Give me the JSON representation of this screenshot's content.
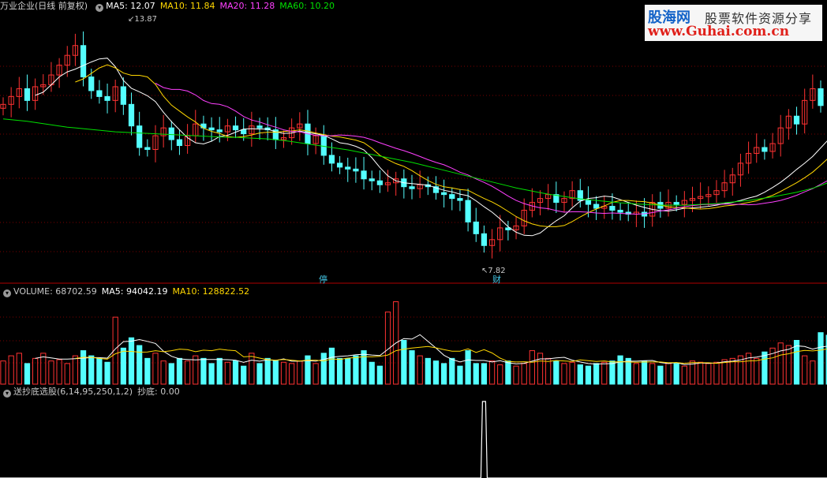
{
  "price_legend": {
    "title": "万业企业(日线 前复权)",
    "items": [
      {
        "label": "MA5: 12.07",
        "color": "#ffffff"
      },
      {
        "label": "MA10: 11.84",
        "color": "#ffd700"
      },
      {
        "label": "MA20: 11.28",
        "color": "#ff40ff"
      },
      {
        "label": "MA60: 10.20",
        "color": "#00e000"
      }
    ]
  },
  "volume_legend": {
    "items": [
      {
        "label": "VOLUME: 68702.59",
        "color": "#c8c8c8"
      },
      {
        "label": "MA5: 94042.19",
        "color": "#ffffff"
      },
      {
        "label": "MA10: 128822.52",
        "color": "#ffd700"
      }
    ]
  },
  "indicator_legend": {
    "items": [
      {
        "label": "送抄底选股(6,14,95,250,1,2)",
        "color": "#c8c8c8"
      },
      {
        "label": "抄底: 0.00",
        "color": "#c8c8c8"
      }
    ]
  },
  "annotations": {
    "high": "13.87",
    "low": "7.82"
  },
  "badges": {
    "b1": "停",
    "b2": "财"
  },
  "watermark": {
    "brand": "股海网",
    "slogan": "股票软件资源分享",
    "url": "www.Guhai.com.cn"
  },
  "colors": {
    "up": "#ff3232",
    "down": "#54ffff",
    "grid": "#7a0000",
    "separator": "#b00000"
  },
  "chart_data": [
    {
      "type": "candlestick",
      "series": [
        {
          "name": "MA5",
          "values": [
            null,
            null,
            null,
            null,
            12.33,
            12.41,
            12.6,
            12.8,
            12.93,
            13.0,
            13.09,
            13.18,
            13.26,
            13.28,
            13.06,
            12.71,
            12.51,
            12.42,
            12.32,
            12.17,
            11.9,
            11.66,
            11.45,
            11.25,
            11.12,
            11.09,
            11.16,
            11.28,
            11.31,
            11.39,
            11.47,
            11.48,
            11.47,
            11.47,
            11.4,
            11.36,
            11.37,
            11.42,
            11.38,
            11.35,
            11.31,
            11.22,
            11.12,
            11.09,
            11.03,
            10.94,
            10.74,
            10.49,
            10.28,
            10.15,
            10.1,
            10.08,
            10.06,
            10.04,
            9.97,
            9.91,
            9.87,
            9.81,
            9.77,
            9.64,
            9.49,
            9.35,
            9.18,
            8.98,
            8.84,
            8.76,
            8.75,
            8.82,
            8.98,
            9.13,
            9.26,
            9.46,
            9.63,
            9.7,
            9.72,
            9.76,
            9.74,
            9.67,
            9.6,
            9.53,
            9.47,
            9.42,
            9.39,
            9.38,
            9.41,
            9.45,
            9.46,
            9.48,
            9.5,
            9.53,
            9.57,
            9.6,
            9.65,
            9.71,
            9.76,
            9.86,
            9.98,
            10.11,
            10.27,
            10.44,
            10.6,
            10.77,
            10.99,
            11.21,
            11.41
          ]
        },
        {
          "name": "MA10",
          "values": [
            null,
            null,
            null,
            null,
            null,
            null,
            null,
            null,
            null,
            12.67,
            12.75,
            12.89,
            13.03,
            13.11,
            13.03,
            12.9,
            12.84,
            12.84,
            12.8,
            12.61,
            12.31,
            12.08,
            11.93,
            11.78,
            11.65,
            11.49,
            11.41,
            11.36,
            11.28,
            11.26,
            11.28,
            11.32,
            11.37,
            11.39,
            11.39,
            11.41,
            11.42,
            11.45,
            11.42,
            11.37,
            11.33,
            11.29,
            11.27,
            11.23,
            11.19,
            11.12,
            10.98,
            10.8,
            10.69,
            10.59,
            10.52,
            10.41,
            10.28,
            10.16,
            10.06,
            10.0,
            9.97,
            9.93,
            9.91,
            9.8,
            9.7,
            9.61,
            9.5,
            9.37,
            9.24,
            9.13,
            9.05,
            9.0,
            8.98,
            8.98,
            9.01,
            9.11,
            9.23,
            9.34,
            9.43,
            9.51,
            9.6,
            9.65,
            9.65,
            9.63,
            9.62,
            9.58,
            9.53,
            9.49,
            9.47,
            9.46,
            9.44,
            9.43,
            9.44,
            9.47,
            9.51,
            9.53,
            9.56,
            9.6,
            9.64,
            9.71,
            9.78,
            9.88,
            9.99,
            10.1,
            10.23,
            10.37,
            10.55,
            10.74,
            10.91
          ]
        },
        {
          "name": "MA20",
          "values": [
            null,
            null,
            null,
            null,
            null,
            null,
            null,
            null,
            null,
            null,
            null,
            null,
            null,
            null,
            null,
            null,
            null,
            null,
            null,
            12.64,
            12.53,
            12.48,
            12.48,
            12.44,
            12.34,
            12.2,
            12.12,
            12.1,
            12.04,
            11.93,
            11.79,
            11.7,
            11.65,
            11.58,
            11.52,
            11.45,
            11.41,
            11.4,
            11.35,
            11.31,
            11.3,
            11.3,
            11.32,
            11.31,
            11.29,
            11.26,
            11.2,
            11.12,
            11.05,
            10.98,
            10.92,
            10.85,
            10.77,
            10.69,
            10.62,
            10.56,
            10.47,
            10.37,
            10.3,
            10.2,
            10.11,
            10.01,
            9.89,
            9.76,
            9.65,
            9.57,
            9.51,
            9.46,
            9.44,
            9.39,
            9.35,
            9.36,
            9.36,
            9.35,
            9.33,
            9.32,
            9.33,
            9.32,
            9.31,
            9.3,
            9.31,
            9.34,
            9.38,
            9.41,
            9.45,
            9.49,
            9.52,
            9.54,
            9.55,
            9.55,
            9.56,
            9.55,
            9.55,
            9.54,
            9.55,
            9.58,
            9.61,
            9.65,
            9.71,
            9.78,
            9.87,
            9.95,
            10.06,
            10.17,
            10.27
          ]
        },
        {
          "name": "MA60",
          "values": [
            11.73,
            11.71,
            11.69,
            11.67,
            11.64,
            11.61,
            11.58,
            11.55,
            11.52,
            11.5,
            11.48,
            11.46,
            11.44,
            11.42,
            11.4,
            11.39,
            11.38,
            11.37,
            11.36,
            11.35,
            11.34,
            11.33,
            11.32,
            11.31,
            11.3,
            11.29,
            11.28,
            11.27,
            11.26,
            11.26,
            11.25,
            11.24,
            11.23,
            11.22,
            11.2,
            11.18,
            11.15,
            11.12,
            11.09,
            11.06,
            11.03,
            11.0,
            10.97,
            10.94,
            10.9,
            10.86,
            10.82,
            10.78,
            10.74,
            10.7,
            10.66,
            10.62,
            10.57,
            10.52,
            10.47,
            10.42,
            10.37,
            10.32,
            10.27,
            10.22,
            10.17,
            10.12,
            10.07,
            10.02,
            9.97,
            9.93,
            9.89,
            9.85,
            9.81,
            9.78,
            9.75,
            9.72,
            9.69,
            9.67,
            9.65,
            9.63,
            9.61,
            9.59,
            9.58,
            9.56,
            9.55,
            9.54,
            9.53,
            9.53,
            9.53,
            9.53,
            9.54,
            9.55,
            9.56,
            9.57,
            9.59,
            9.61,
            9.63,
            9.65,
            9.68,
            9.71,
            9.74,
            9.78,
            9.82,
            9.86,
            9.91,
            9.96,
            10.03,
            10.11,
            10.2
          ]
        }
      ],
      "close": [
        12.1,
        12.3,
        12.5,
        12.2,
        12.55,
        12.6,
        12.85,
        13.1,
        13.35,
        13.6,
        12.8,
        12.45,
        12.3,
        12.2,
        12.55,
        12.1,
        11.55,
        11.0,
        10.95,
        11.3,
        11.5,
        11.2,
        11.05,
        11.3,
        11.6,
        11.5,
        11.45,
        11.4,
        11.55,
        11.45,
        11.35,
        11.55,
        11.5,
        11.45,
        11.2,
        11.25,
        11.5,
        11.6,
        11.1,
        11.3,
        10.8,
        10.6,
        10.5,
        10.45,
        10.4,
        10.2,
        10.15,
        10.05,
        10.1,
        10.2,
        10.0,
        9.95,
        10.05,
        10.0,
        9.85,
        9.8,
        9.7,
        9.65,
        9.1,
        8.8,
        8.5,
        8.65,
        8.95,
        8.9,
        9.0,
        9.4,
        9.6,
        9.7,
        9.8,
        9.6,
        9.7,
        9.9,
        9.65,
        9.55,
        9.45,
        9.5,
        9.4,
        9.35,
        9.3,
        9.35,
        9.25,
        9.6,
        9.45,
        9.6,
        9.55,
        9.65,
        9.7,
        9.75,
        9.8,
        9.9,
        10.1,
        10.3,
        10.6,
        10.85,
        11.0,
        10.9,
        11.1,
        11.5,
        11.8,
        11.6,
        12.2,
        12.5,
        12.07
      ]
    },
    {
      "type": "bar",
      "series": [
        {
          "name": "VOLUME",
          "values": [
            90,
            110,
            120,
            80,
            100,
            120,
            90,
            95,
            80,
            110,
            130,
            110,
            100,
            85,
            260,
            140,
            180,
            150,
            100,
            120,
            90,
            80,
            100,
            90,
            110,
            100,
            80,
            100,
            85,
            90,
            70,
            120,
            80,
            100,
            90,
            85,
            80,
            90,
            110,
            80,
            120,
            140,
            100,
            100,
            110,
            130,
            85,
            70,
            280,
            320,
            170,
            130,
            110,
            100,
            90,
            80,
            100,
            70,
            130,
            80,
            80,
            90,
            75,
            90,
            70,
            80,
            130,
            120,
            100,
            90,
            80,
            85,
            75,
            70,
            80,
            85,
            90,
            110,
            100,
            80,
            90,
            80,
            70,
            80,
            80,
            70,
            90,
            85,
            80,
            85,
            95,
            100,
            110,
            120,
            100,
            125,
            140,
            160,
            150,
            170,
            110,
            90,
            200,
            190,
            68.7
          ]
        },
        {
          "name": "MA5",
          "values": [
            null,
            null,
            null,
            null,
            100,
            106,
            102,
            97,
            97,
            99,
            101,
            103,
            103,
            101,
            137,
            165,
            167,
            173,
            166,
            158,
            128,
            108,
            98,
            96,
            94,
            96,
            96,
            96,
            95,
            93,
            85,
            93,
            89,
            94,
            92,
            98,
            89,
            89,
            91,
            89,
            96,
            104,
            108,
            110,
            114,
            116,
            113,
            111,
            135,
            160,
            177,
            175,
            192,
            166,
            140,
            112,
            96,
            86,
            94,
            92,
            92,
            86,
            91,
            83,
            79,
            81,
            89,
            98,
            98,
            102,
            104,
            93,
            86,
            80,
            78,
            79,
            80,
            86,
            89,
            89,
            91,
            92,
            84,
            80,
            84,
            76,
            78,
            82,
            81,
            82,
            87,
            89,
            94,
            102,
            105,
            111,
            119,
            129,
            135,
            149,
            146,
            136,
            144,
            148,
            124
          ]
        },
        {
          "name": "MA10",
          "values": [
            null,
            null,
            null,
            null,
            null,
            null,
            null,
            null,
            null,
            100,
            104,
            104,
            100,
            97,
            118,
            128,
            127,
            124,
            125,
            130,
            126,
            130,
            136,
            134,
            126,
            132,
            130,
            136,
            132,
            130,
            106,
            108,
            101,
            95,
            93,
            96,
            93,
            90,
            93,
            93,
            90,
            98,
            96,
            101,
            103,
            107,
            106,
            108,
            113,
            130,
            136,
            140,
            143,
            146,
            141,
            134,
            128,
            128,
            137,
            123,
            134,
            121,
            101,
            88,
            86,
            87,
            85,
            90,
            88,
            92,
            90,
            88,
            94,
            91,
            88,
            90,
            86,
            87,
            86,
            85,
            86,
            86,
            86,
            83,
            84,
            81,
            84,
            83,
            83,
            81,
            84,
            87,
            87,
            90,
            91,
            97,
            102,
            113,
            118,
            126,
            131,
            129,
            132,
            138,
            137
          ]
        }
      ]
    },
    {
      "type": "line",
      "series": [
        {
          "name": "抄底",
          "values": [
            0,
            0,
            0,
            0,
            0,
            0,
            0,
            0,
            0,
            0,
            0,
            0,
            0,
            0,
            0,
            0,
            0,
            0,
            0,
            0,
            0,
            0,
            0,
            0,
            0,
            0,
            0,
            0,
            0,
            0,
            0,
            0,
            0,
            0,
            0,
            0,
            0,
            0,
            0,
            0,
            0,
            0,
            0,
            0,
            0,
            0,
            0,
            0,
            0,
            0,
            0,
            0,
            0,
            0,
            0,
            0,
            0,
            0,
            0,
            0,
            1,
            0,
            0,
            0,
            0,
            0,
            0,
            0,
            0,
            0,
            0,
            0,
            0,
            0,
            0,
            0,
            0,
            0,
            0,
            0,
            0,
            0,
            0,
            0,
            0,
            0,
            0,
            0,
            0,
            0,
            0,
            0,
            0,
            0,
            0,
            0,
            0,
            0,
            0,
            0,
            0,
            0,
            0,
            0,
            0
          ]
        }
      ]
    }
  ]
}
